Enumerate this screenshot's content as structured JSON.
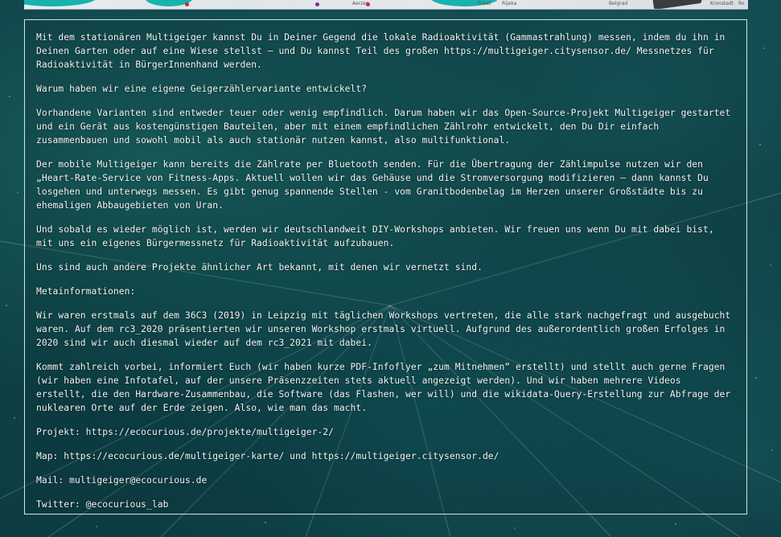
{
  "header_map": {
    "labels": [
      "Aerzen",
      "Triest",
      "Rijeka",
      "Belgrad",
      "Kronstadt",
      "Ro"
    ],
    "colors": {
      "turquoise": "#17b3ac",
      "red": "#d9232d",
      "purple": "#7a2aa8"
    }
  },
  "article": {
    "paragraphs": [
      "Mit dem stationären Multigeiger kannst Du in Deiner Gegend die lokale Radioaktivität (Gammastrahlung) messen, indem du ihn in Deinen Garten oder auf eine Wiese stellst – und Du kannst Teil des großen https://multigeiger.citysensor.de/ Messnetzes für Radioaktivität in BürgerInnenhand werden.",
      "Warum haben wir eine eigene Geigerzählervariante entwickelt?",
      "Vorhandene Varianten sind entweder teuer oder wenig empfindlich. Darum haben wir das Open-Source-Projekt Multigeiger gestartet und ein Gerät aus kostengünstigen Bauteilen, aber mit einem empfindlichen Zählrohr entwickelt, den Du Dir einfach zusammenbauen und sowohl mobil als auch stationär nutzen kannst, also multifunktional.",
      "Der mobile Multigeiger kann bereits die Zählrate per Bluetooth senden. Für die Übertragung der Zählimpulse nutzen wir den „Heart-Rate-Service von Fitness-Apps. Aktuell wollen wir das Gehäuse und die Stromversorgung modifizieren – dann kannst Du losgehen und unterwegs messen. Es gibt genug spannende Stellen - vom Granitbodenbelag im Herzen unserer Großstädte bis zu ehemaligen Abbaugebieten von Uran.",
      "Und sobald es wieder möglich ist, werden wir deutschlandweit DIY-Workshops anbieten. Wir freuen uns wenn Du mit dabei bist, mit uns ein eigenes Bürgermessnetz für Radioaktivität aufzubauen.",
      "Uns sind auch andere Projekte ähnlicher Art bekannt, mit denen wir vernetzt sind.",
      "Metainformationen:",
      "Wir waren erstmals auf dem 36C3 (2019) in Leipzig mit täglichen Workshops vertreten, die alle stark nachgefragt und ausgebucht waren. Auf dem rc3_2020 präsentierten wir unseren Workshop erstmals virtuell. Aufgrund des außerordentlich großen Erfolges in 2020 sind wir auch diesmal wieder auf dem rc3_2021 mit dabei.",
      "Kommt zahlreich vorbei, informiert Euch (wir haben kurze PDF-Infoflyer „zum Mitnehmen“ erstellt) und stellt auch gerne Fragen (wir haben eine Infotafel, auf der unsere Präsenzzeiten stets aktuell angezeigt werden). Und wir haben mehrere Videos erstellt, die den Hardware-Zusammenbau, die Software (das Flashen, wer will) und die wikidata-Query-Erstellung zur Abfrage der nuklearen Orte auf der Erde zeigen. Also, wie man das macht.",
      "Projekt: https://ecocurious.de/projekte/multigeiger-2/",
      "Map: https://ecocurious.de/multigeiger-karte/ und https://multigeiger.citysensor.de/",
      "Mail: multigeiger@ecocurious.de",
      "Twitter: @ecocurious_lab"
    ]
  },
  "theme": {
    "text_color": "#f2f5f4",
    "border_color": "#cfe6e3",
    "background_color": "#0c3a41"
  }
}
